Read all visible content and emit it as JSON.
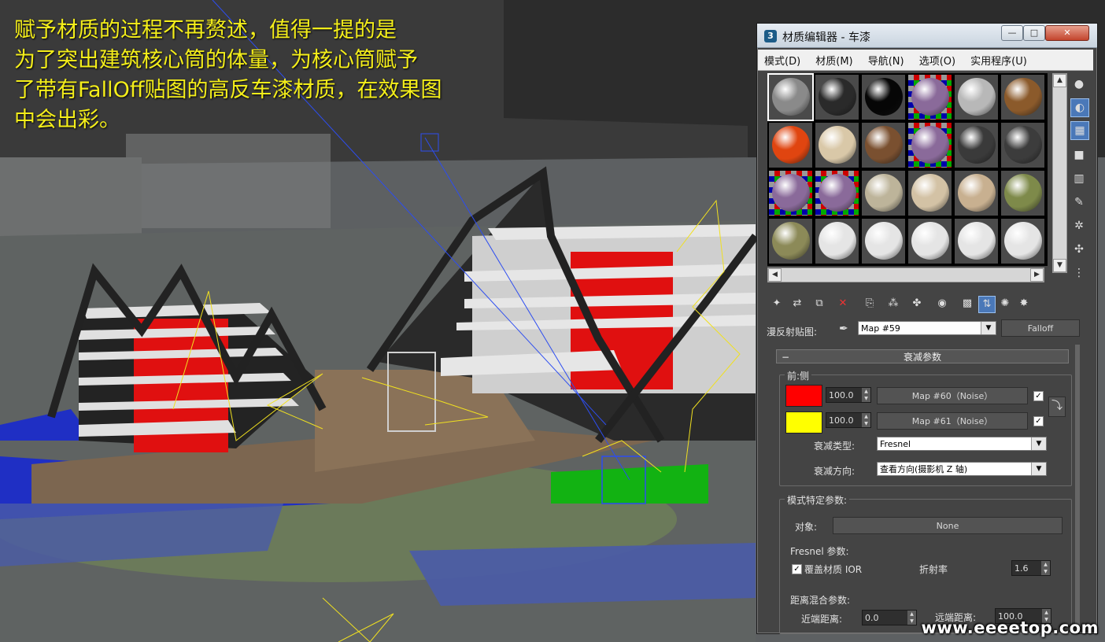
{
  "caption": {
    "lines": [
      "赋予材质的过程不再赘述，值得一提的是",
      "为了突出建筑核心筒的体量，为核心筒赋予",
      "了带有FallOff贴图的高反车漆材质，在效果图",
      "中会出彩。"
    ]
  },
  "watermark": "www.eeeetop.com",
  "window": {
    "title": "材质编辑器 - 车漆",
    "app_icon": "3ds-max-icon",
    "buttons": {
      "minimize": "—",
      "maximize": "□",
      "close": "✕"
    }
  },
  "menu": [
    "模式(D)",
    "材质(M)",
    "导航(N)",
    "选项(O)",
    "实用程序(U)"
  ],
  "slots": {
    "colors": [
      [
        "#8a8a8a",
        "#2a2a2a",
        "#060606",
        "checker",
        "#b8b8b8",
        "#8b5a2b"
      ],
      [
        "#e04510",
        "#d9c8a8",
        "#7a5030",
        "checker",
        "#3a3a3a",
        "#3c3c3c"
      ],
      [
        "checker",
        "checker",
        "#bdb49a",
        "#d3c2a5",
        "#c8b090",
        "#7e8a4a"
      ],
      [
        "#8c8a58",
        "#e5e5e5",
        "#e5e5e5",
        "#e5e5e5",
        "#e5e5e5",
        "#e5e5e5"
      ]
    ]
  },
  "diffuse_map": {
    "label": "漫反射贴图:",
    "map_name": "Map #59",
    "map_type": "Falloff"
  },
  "falloff_params": {
    "header": "衰减参数",
    "group_label": "前:侧",
    "front": {
      "color": "#ff0000",
      "amount": "100.0",
      "map": "Map #60（Noise）",
      "checked": "✓"
    },
    "side": {
      "color": "#ffff00",
      "amount": "100.0",
      "map": "Map #61（Noise）",
      "checked": "✓"
    },
    "falloff_type_label": "衰减类型:",
    "falloff_type": "Fresnel",
    "falloff_dir_label": "衰减方向:",
    "falloff_dir": "查看方向(摄影机 Z 轴)"
  },
  "mode_params": {
    "group_label": "模式特定参数:",
    "object_label": "对象:",
    "object_value": "None",
    "fresnel_label": "Fresnel 参数:",
    "override_ior_label": "覆盖材质 IOR",
    "override_ior_checked": "✓",
    "ior_label": "折射率",
    "ior_value": "1.6",
    "distance_label": "距离混合参数:",
    "near_label": "近端距离:",
    "near_value": "0.0",
    "far_label": "远端距离:",
    "far_value": "100.0"
  }
}
